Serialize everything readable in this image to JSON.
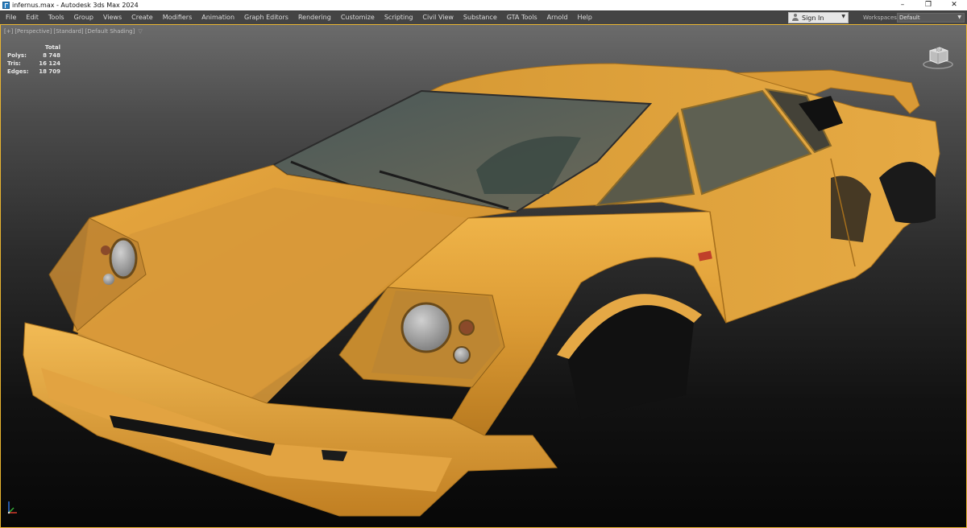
{
  "window": {
    "title": "infernus.max - Autodesk 3ds Max 2024",
    "controls": [
      "minimize-icon",
      "restore-icon",
      "close-icon"
    ],
    "control_glyphs": [
      "–",
      "❐",
      "✕"
    ]
  },
  "menubar": {
    "items": [
      "File",
      "Edit",
      "Tools",
      "Group",
      "Views",
      "Create",
      "Modifiers",
      "Animation",
      "Graph Editors",
      "Rendering",
      "Customize",
      "Scripting",
      "Civil View",
      "Substance",
      "GTA Tools",
      "Arnold",
      "Help"
    ],
    "signin_label": "Sign In",
    "workspaces_label": "Workspaces:",
    "workspace_value": "Default"
  },
  "viewport": {
    "labels": [
      "[+]",
      "[Perspective]",
      "[Standard]",
      "[Default Shading]"
    ],
    "filter_glyph": "▽",
    "stats": {
      "header": "Total",
      "rows": [
        {
          "label": "Polys:",
          "value": "8 748"
        },
        {
          "label": "Tris:",
          "value": "16 124"
        },
        {
          "label": "Edges:",
          "value": "18 709"
        }
      ]
    },
    "border_color": "#e8b430",
    "model_color": "#e3a23a",
    "viewcube_label": "TOP"
  }
}
